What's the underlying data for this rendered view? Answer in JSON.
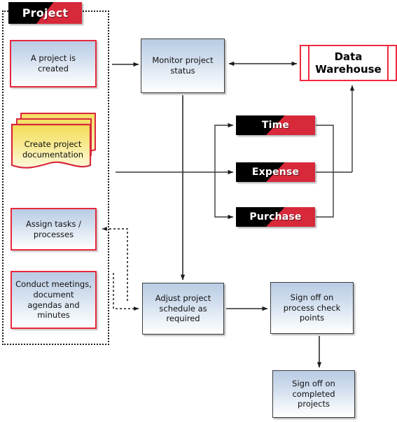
{
  "diagram": {
    "title": "Project",
    "group": {
      "banner_label": "Project",
      "boundary_name": "project-scope-boundary"
    },
    "nodes": {
      "project_created": {
        "label": "A project is created",
        "shape": "process",
        "border_color": "#e8283c"
      },
      "create_documentation": {
        "label": "Create project documentation",
        "shape": "multi-document",
        "border_color": "#d8283c",
        "fill": "#f6e97f"
      },
      "assign_tasks": {
        "label": "Assign tasks / processes",
        "shape": "process",
        "border_color": "#e8283c"
      },
      "conduct_meetings": {
        "label": "Conduct meetings, document agendas and minutes",
        "shape": "process",
        "border_color": "#e8283c"
      },
      "monitor_status": {
        "label": "Monitor project status",
        "shape": "process",
        "border_color": "#3d3d3d"
      },
      "data_warehouse": {
        "label": "Data Warehouse",
        "shape": "stored-data",
        "border_color": "#ef2a3c"
      },
      "time": {
        "label": "Time",
        "shape": "banner",
        "colors": [
          "#000000",
          "#d8293b"
        ]
      },
      "expense": {
        "label": "Expense",
        "shape": "banner",
        "colors": [
          "#000000",
          "#d8293b"
        ]
      },
      "purchase": {
        "label": "Purchase",
        "shape": "banner",
        "colors": [
          "#000000",
          "#d8293b"
        ]
      },
      "adjust_schedule": {
        "label": "Adjust project schedule as required",
        "shape": "process",
        "border_color": "#3d3d3d"
      },
      "sign_off_checkpoints": {
        "label": "Sign off on process check points",
        "shape": "process",
        "border_color": "#3d3d3d"
      },
      "sign_off_completed": {
        "label": "Sign off on completed projects",
        "shape": "process",
        "border_color": "#3d3d3d"
      }
    },
    "edges": [
      {
        "from": "project_created",
        "to": "monitor_status",
        "style": "solid",
        "arrow": "single"
      },
      {
        "from": "monitor_status",
        "to": "data_warehouse",
        "style": "solid",
        "arrow": "double"
      },
      {
        "from": "monitor_status",
        "to": "adjust_schedule",
        "style": "solid",
        "arrow": "single"
      },
      {
        "from": "create_documentation",
        "to": "time",
        "style": "solid",
        "arrow": "single"
      },
      {
        "from": "create_documentation",
        "to": "expense",
        "style": "solid",
        "arrow": "single"
      },
      {
        "from": "create_documentation",
        "to": "purchase",
        "style": "solid",
        "arrow": "single"
      },
      {
        "from": "time",
        "to": "data_warehouse",
        "style": "solid",
        "arrow": "single"
      },
      {
        "from": "expense",
        "to": "data_warehouse",
        "style": "solid",
        "arrow": "single"
      },
      {
        "from": "purchase",
        "to": "data_warehouse",
        "style": "solid",
        "arrow": "single"
      },
      {
        "from": "project_scope",
        "to": "assign_tasks",
        "style": "dotted",
        "arrow": "single"
      },
      {
        "from": "project_scope",
        "to": "adjust_schedule",
        "style": "dotted",
        "arrow": "single"
      },
      {
        "from": "adjust_schedule",
        "to": "sign_off_checkpoints",
        "style": "solid",
        "arrow": "single"
      },
      {
        "from": "sign_off_checkpoints",
        "to": "sign_off_completed",
        "style": "solid",
        "arrow": "single"
      }
    ]
  }
}
